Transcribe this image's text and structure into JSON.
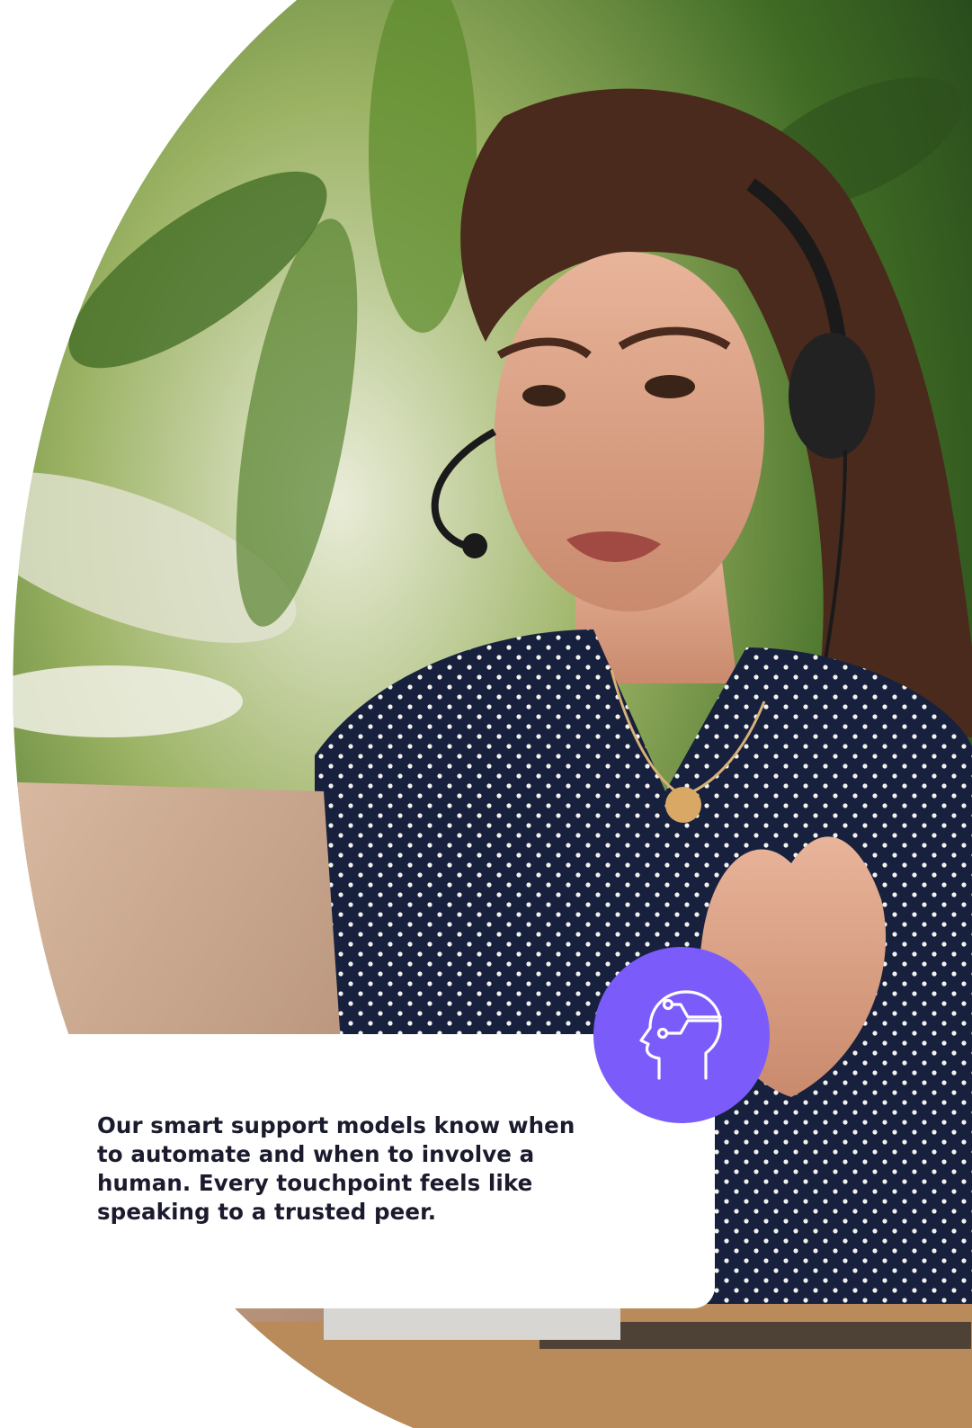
{
  "caption": {
    "text": "Our smart support models know when to automate and when to involve a human. Every touchpoint feels like speaking to a trusted peer."
  },
  "badge": {
    "icon": "ai-head-icon",
    "color": "#7B5CFA"
  },
  "photo": {
    "subject": "customer-support-agent-photo"
  }
}
